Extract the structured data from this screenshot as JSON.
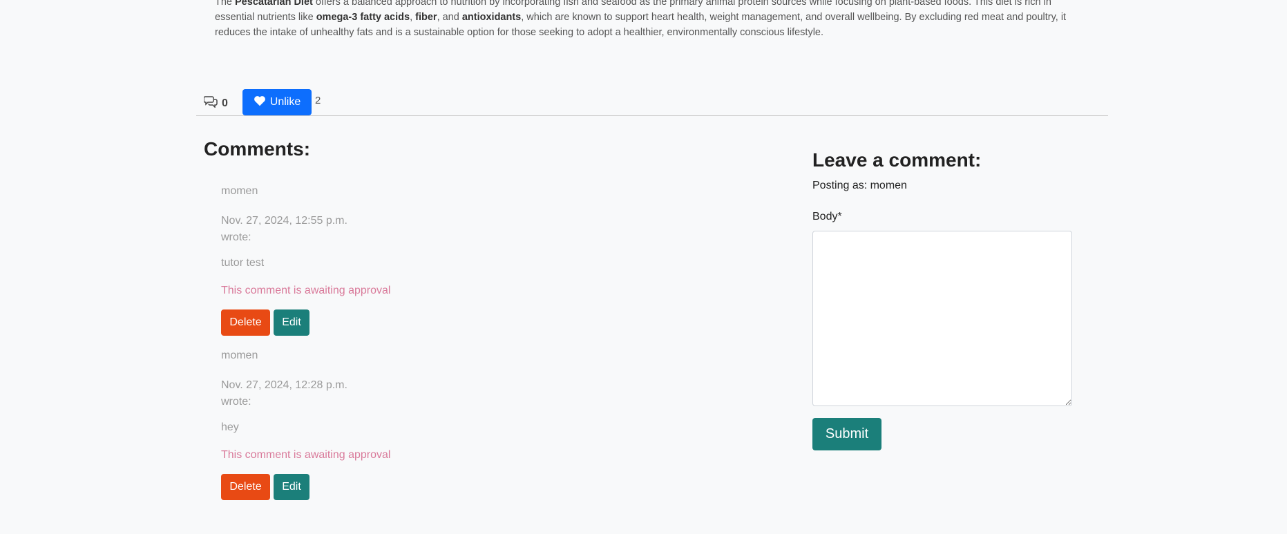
{
  "article": {
    "intro_1": "The ",
    "diet_name": "Pescatarian Diet",
    "intro_2": " offers a balanced approach to nutrition by incorporating fish and seafood as the primary animal protein sources while focusing on plant-based foods. This diet is rich in essential nutrients like ",
    "nutrient_1": "omega-3 fatty acids",
    "sep_1": ", ",
    "nutrient_2": "fiber",
    "sep_2": ", and ",
    "nutrient_3": "antioxidants",
    "outro": ", which are known to support heart health, weight management, and overall wellbeing. By excluding red meat and poultry, it reduces the intake of unhealthy fats and is a sustainable option for those seeking to adopt a healthier, environmentally conscious lifestyle."
  },
  "stats": {
    "comment_count": "0",
    "like_button_label": "Unlike",
    "like_count": "2"
  },
  "comments_section": {
    "heading": "Comments:",
    "comments": [
      {
        "author": "momen",
        "date": "Nov. 27, 2024, 12:55 p.m.",
        "wrote": "wrote:",
        "body": "tutor test",
        "pending": "This comment is awaiting approval",
        "delete_label": "Delete",
        "edit_label": "Edit"
      },
      {
        "author": "momen",
        "date": "Nov. 27, 2024, 12:28 p.m.",
        "wrote": "wrote:",
        "body": "hey",
        "pending": "This comment is awaiting approval",
        "delete_label": "Delete",
        "edit_label": "Edit"
      }
    ]
  },
  "comment_form": {
    "heading": "Leave a comment:",
    "posting_as": "Posting as: momen",
    "body_label": "Body*",
    "body_value": "",
    "submit_label": "Submit"
  },
  "colors": {
    "primary": "#0d6efd",
    "delete": "#e84a14",
    "teal": "#1b7f7a",
    "pending": "#d97a9a"
  },
  "icons": {
    "comments": "chat-bubbles-icon",
    "like": "heart-icon"
  }
}
